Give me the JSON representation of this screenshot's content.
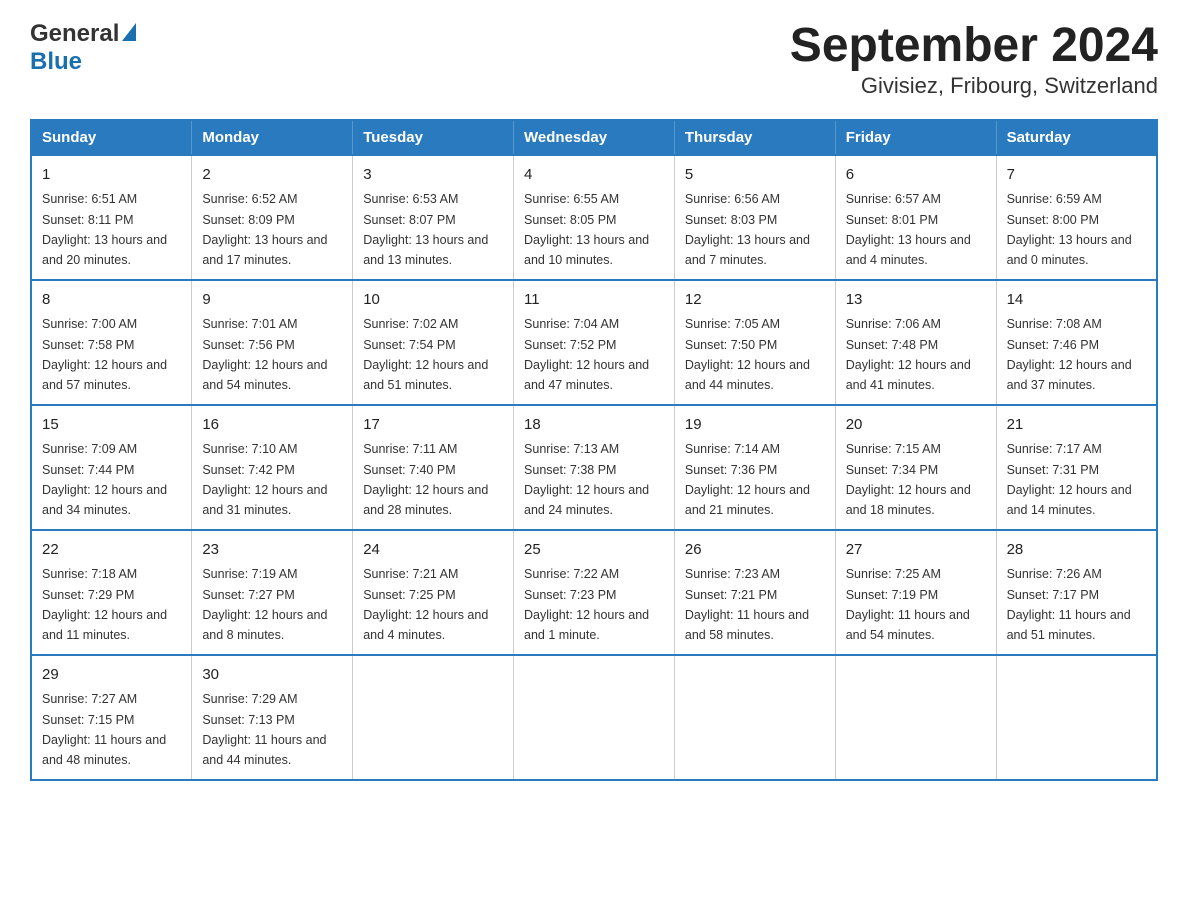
{
  "header": {
    "logo_general": "General",
    "logo_blue": "Blue",
    "title": "September 2024",
    "subtitle": "Givisiez, Fribourg, Switzerland"
  },
  "days_of_week": [
    "Sunday",
    "Monday",
    "Tuesday",
    "Wednesday",
    "Thursday",
    "Friday",
    "Saturday"
  ],
  "weeks": [
    [
      {
        "day": "1",
        "sunrise": "6:51 AM",
        "sunset": "8:11 PM",
        "daylight": "13 hours and 20 minutes."
      },
      {
        "day": "2",
        "sunrise": "6:52 AM",
        "sunset": "8:09 PM",
        "daylight": "13 hours and 17 minutes."
      },
      {
        "day": "3",
        "sunrise": "6:53 AM",
        "sunset": "8:07 PM",
        "daylight": "13 hours and 13 minutes."
      },
      {
        "day": "4",
        "sunrise": "6:55 AM",
        "sunset": "8:05 PM",
        "daylight": "13 hours and 10 minutes."
      },
      {
        "day": "5",
        "sunrise": "6:56 AM",
        "sunset": "8:03 PM",
        "daylight": "13 hours and 7 minutes."
      },
      {
        "day": "6",
        "sunrise": "6:57 AM",
        "sunset": "8:01 PM",
        "daylight": "13 hours and 4 minutes."
      },
      {
        "day": "7",
        "sunrise": "6:59 AM",
        "sunset": "8:00 PM",
        "daylight": "13 hours and 0 minutes."
      }
    ],
    [
      {
        "day": "8",
        "sunrise": "7:00 AM",
        "sunset": "7:58 PM",
        "daylight": "12 hours and 57 minutes."
      },
      {
        "day": "9",
        "sunrise": "7:01 AM",
        "sunset": "7:56 PM",
        "daylight": "12 hours and 54 minutes."
      },
      {
        "day": "10",
        "sunrise": "7:02 AM",
        "sunset": "7:54 PM",
        "daylight": "12 hours and 51 minutes."
      },
      {
        "day": "11",
        "sunrise": "7:04 AM",
        "sunset": "7:52 PM",
        "daylight": "12 hours and 47 minutes."
      },
      {
        "day": "12",
        "sunrise": "7:05 AM",
        "sunset": "7:50 PM",
        "daylight": "12 hours and 44 minutes."
      },
      {
        "day": "13",
        "sunrise": "7:06 AM",
        "sunset": "7:48 PM",
        "daylight": "12 hours and 41 minutes."
      },
      {
        "day": "14",
        "sunrise": "7:08 AM",
        "sunset": "7:46 PM",
        "daylight": "12 hours and 37 minutes."
      }
    ],
    [
      {
        "day": "15",
        "sunrise": "7:09 AM",
        "sunset": "7:44 PM",
        "daylight": "12 hours and 34 minutes."
      },
      {
        "day": "16",
        "sunrise": "7:10 AM",
        "sunset": "7:42 PM",
        "daylight": "12 hours and 31 minutes."
      },
      {
        "day": "17",
        "sunrise": "7:11 AM",
        "sunset": "7:40 PM",
        "daylight": "12 hours and 28 minutes."
      },
      {
        "day": "18",
        "sunrise": "7:13 AM",
        "sunset": "7:38 PM",
        "daylight": "12 hours and 24 minutes."
      },
      {
        "day": "19",
        "sunrise": "7:14 AM",
        "sunset": "7:36 PM",
        "daylight": "12 hours and 21 minutes."
      },
      {
        "day": "20",
        "sunrise": "7:15 AM",
        "sunset": "7:34 PM",
        "daylight": "12 hours and 18 minutes."
      },
      {
        "day": "21",
        "sunrise": "7:17 AM",
        "sunset": "7:31 PM",
        "daylight": "12 hours and 14 minutes."
      }
    ],
    [
      {
        "day": "22",
        "sunrise": "7:18 AM",
        "sunset": "7:29 PM",
        "daylight": "12 hours and 11 minutes."
      },
      {
        "day": "23",
        "sunrise": "7:19 AM",
        "sunset": "7:27 PM",
        "daylight": "12 hours and 8 minutes."
      },
      {
        "day": "24",
        "sunrise": "7:21 AM",
        "sunset": "7:25 PM",
        "daylight": "12 hours and 4 minutes."
      },
      {
        "day": "25",
        "sunrise": "7:22 AM",
        "sunset": "7:23 PM",
        "daylight": "12 hours and 1 minute."
      },
      {
        "day": "26",
        "sunrise": "7:23 AM",
        "sunset": "7:21 PM",
        "daylight": "11 hours and 58 minutes."
      },
      {
        "day": "27",
        "sunrise": "7:25 AM",
        "sunset": "7:19 PM",
        "daylight": "11 hours and 54 minutes."
      },
      {
        "day": "28",
        "sunrise": "7:26 AM",
        "sunset": "7:17 PM",
        "daylight": "11 hours and 51 minutes."
      }
    ],
    [
      {
        "day": "29",
        "sunrise": "7:27 AM",
        "sunset": "7:15 PM",
        "daylight": "11 hours and 48 minutes."
      },
      {
        "day": "30",
        "sunrise": "7:29 AM",
        "sunset": "7:13 PM",
        "daylight": "11 hours and 44 minutes."
      },
      null,
      null,
      null,
      null,
      null
    ]
  ],
  "labels": {
    "sunrise": "Sunrise:",
    "sunset": "Sunset:",
    "daylight": "Daylight:"
  }
}
